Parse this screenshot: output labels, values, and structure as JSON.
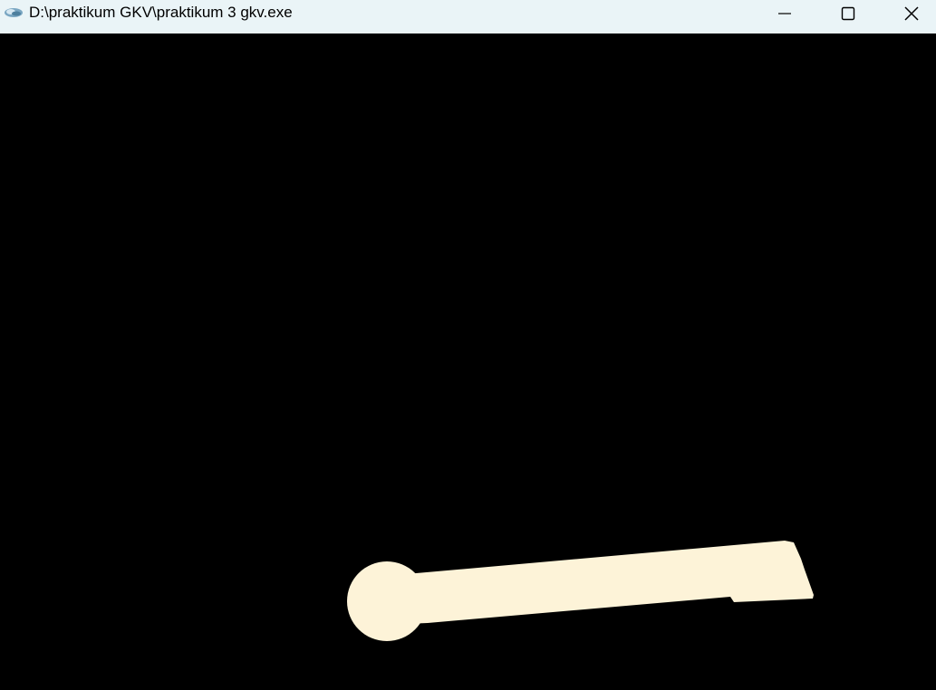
{
  "window": {
    "title": "D:\\praktikum GKV\\praktikum 3 gkv.exe",
    "app_icon": "opengl-app-icon",
    "controls": {
      "minimize_icon": "minimize-icon",
      "maximize_icon": "maximize-icon",
      "close_icon": "close-icon"
    }
  },
  "scene": {
    "background_color": "#000000",
    "shape_color": "#fdf3d8",
    "shape": "lollipop-shaped arm with round head and rectangular handle"
  }
}
